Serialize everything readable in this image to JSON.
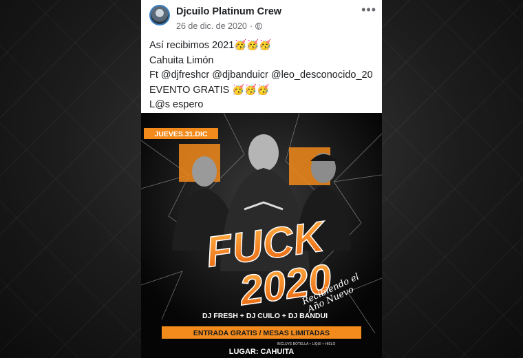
{
  "post": {
    "author": "Djcuilo Platinum Crew",
    "date": "26 de dic. de 2020",
    "separator": "·",
    "more": "•••",
    "lines": [
      "Así recibimos 2021🥳🥳🥳",
      "Cahuita Limón",
      "Ft @djfreshcr @djbanduicr @leo_desconocido_20",
      "EVENTO GRATIS 🥳🥳🥳",
      "L@s espero"
    ]
  },
  "flyer": {
    "date_banner": "JUEVES.31.DIC",
    "title_line1": "FUCK",
    "title_line2": "2020",
    "subtitle_line1": "Recibiendo el",
    "subtitle_line2": "Año Nuevo",
    "djs": "DJ FRESH + DJ CUILO + DJ BANDUI",
    "entry": "ENTRADA GRATIS / MESAS LIMITADAS",
    "includes": "INCLUYE BOTELLA + LIQUI + HIELO",
    "location": "LUGAR: CAHUITA"
  },
  "colors": {
    "accent_orange": "#f28a1c",
    "post_bg": "#ffffff",
    "text": "#1c1e21",
    "meta": "#65676b"
  }
}
